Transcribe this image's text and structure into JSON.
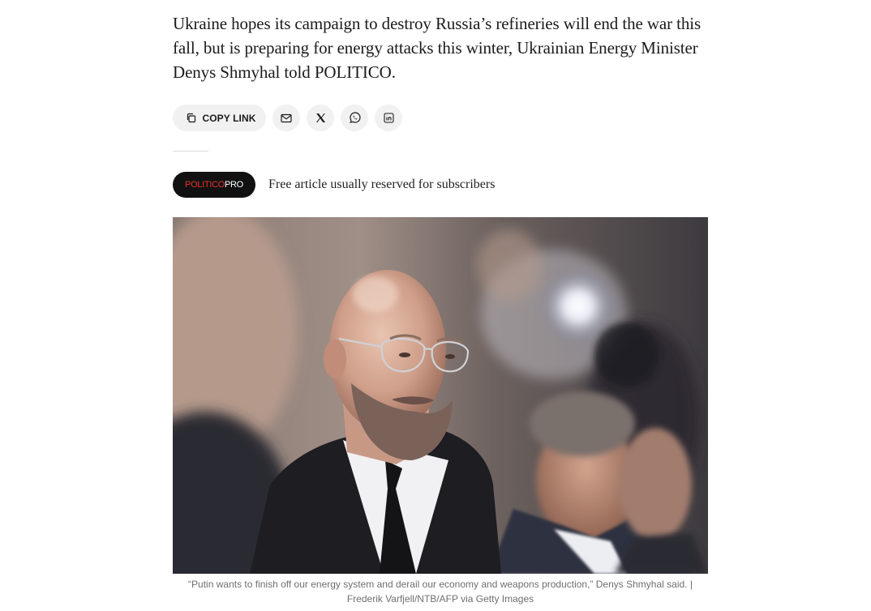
{
  "article": {
    "dek": "Ukraine hopes its campaign to destroy Russia’s refineries will end the war this fall, but is preparing for energy attacks this winter, Ukrainian Energy Minister Denys Shmyhal told POLITICO."
  },
  "share": {
    "copy_link_label": "COPY LINK",
    "icons": [
      "copy-icon",
      "mail-icon",
      "x-icon",
      "whatsapp-icon",
      "linkedin-icon"
    ]
  },
  "pro_badge": {
    "brand_part1": "POLITICO",
    "brand_part2": "PRO",
    "note": "Free article usually reserved for subscribers"
  },
  "photo": {
    "caption_quote": "“Putin wants to finish off our energy system and derail our economy and weapons production,” Denys Shmyhal said. |",
    "caption_credit": "Frederik Varfjell/NTB/AFP via Getty Images"
  },
  "colors": {
    "brand_red": "#e5322d",
    "badge_bg": "#111111",
    "button_bg": "#f1f1f1"
  }
}
